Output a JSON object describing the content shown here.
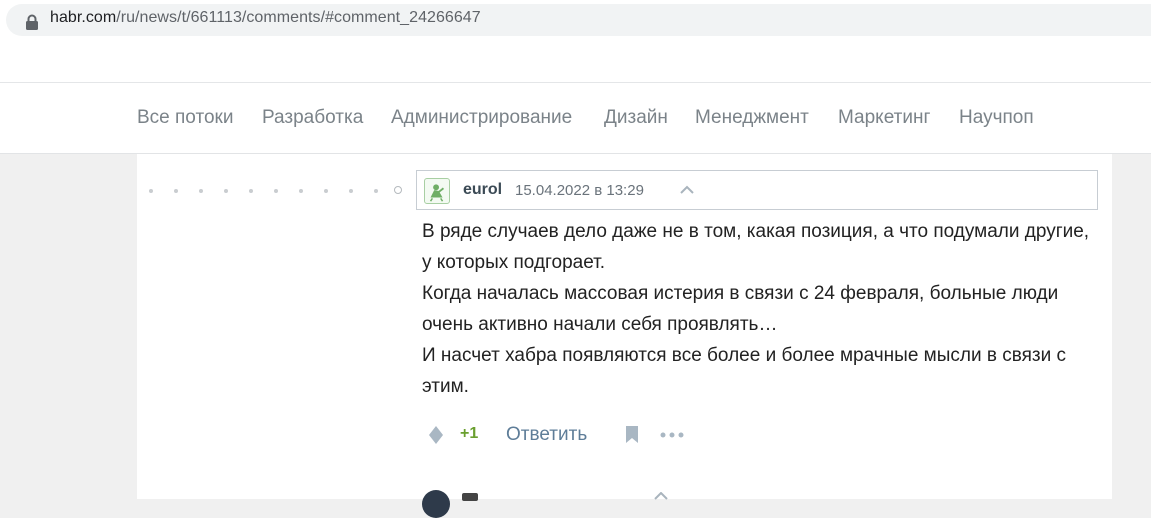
{
  "browser": {
    "url_host": "habr.com",
    "url_path": "/ru/news/t/661113/comments/#comment_24266647"
  },
  "nav": {
    "flows": [
      {
        "label": "Все потоки"
      },
      {
        "label": "Разработка"
      },
      {
        "label": "Администрирование"
      },
      {
        "label": "Дизайн"
      },
      {
        "label": "Менеджмент"
      },
      {
        "label": "Маркетинг"
      },
      {
        "label": "Научпоп"
      }
    ]
  },
  "comment": {
    "username": "eurol",
    "datetime": "15.04.2022 в 13:29",
    "body": [
      "В ряде случаев дело даже не в том, какая позиция, а что подумали другие, у которых подгорает.",
      "Когда началась массовая истерия в связи с 24 февраля, больные люди очень активно начали себя проявлять…",
      "И насчет хабра появляются все более и более мрачные мысли в связи с этим."
    ],
    "score": "+1",
    "reply_label": "Ответить"
  },
  "colors": {
    "accent_link": "#5e7d98",
    "score_positive": "#6a9f2f",
    "nav_text": "#7b8389"
  },
  "icons": {
    "lock": "lock-icon",
    "avatar": "avatar-icon",
    "collapse": "chevron-up-icon",
    "vote": "vote-diamond-icon",
    "bookmark": "bookmark-icon",
    "more": "more-dots-icon"
  }
}
